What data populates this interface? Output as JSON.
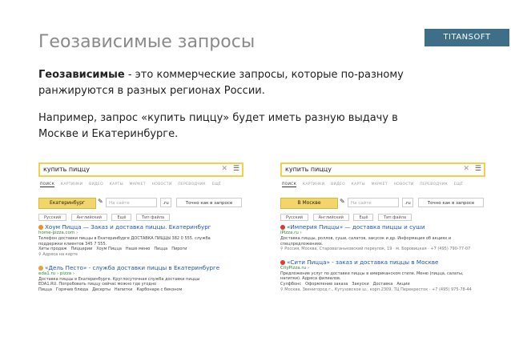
{
  "slide": {
    "title": "Геозависимые запросы",
    "logo": "TITANSOFT",
    "p1_bold": "Геозависимые",
    "p1_rest": " - это коммерческие запросы, которые по-разному ранжируются в разных регионах России.",
    "p2": "Например, запрос «купить пиццу» будет иметь разную выдачу в Москве и Екатеринбурге."
  },
  "serps": [
    {
      "query": "купить пиццу",
      "tabs": [
        "ПОИСК",
        "КАРТИНКИ",
        "ВИДЕО",
        "КАРТЫ",
        "МАРКЕТ",
        "НОВОСТИ",
        "ПЕРЕВОДЧИК",
        "ЕЩЁ"
      ],
      "region": "Екатеринбург",
      "site_placeholder": "На сайте",
      "domain": ".ru",
      "exact": "Точно как в запросе",
      "langs": [
        "Русский",
        "Английский",
        "Ещё",
        "Тип файла"
      ],
      "results": [
        {
          "title": "Хоум Пицца — Заказ и доставка пиццы. Екатеринбург",
          "url": "home-pizza.com ›",
          "snippet": [
            "Телефон доставки пиццы в Екатеринбурге ДОСТАВКА ПИЦЦЫ 382 0 555. служба",
            "поддержки клиентов 345 7 555."
          ],
          "links": [
            "Хиты продаж",
            "Пиццерии",
            "Хоум Пицца",
            "Наше меню",
            "Пицца",
            "Пироги"
          ],
          "addr": "Адреса на карте"
        },
        {
          "title": "«Дель Песто» - служба доставки пиццы в Екатеринбурге",
          "url": "eda1.ru › pizza ›",
          "snippet": [
            "Доставка пиццы в Екатеринбурге. Круглосуточная служба доставки пиццы",
            "EDA1.RU. Попробовать пиццу сейчас можно где угодно"
          ],
          "links": [
            "Пицца",
            "Горячие блюда",
            "Десерты",
            "Напитки",
            "Карбонаре с беконом"
          ],
          "addr": ""
        }
      ]
    },
    {
      "query": "купить пиццу",
      "tabs": [
        "ПОИСК",
        "КАРТИНКИ",
        "ВИДЕО",
        "КАРТЫ",
        "МАРКЕТ",
        "НОВОСТИ",
        "ПЕРЕВОДЧИК",
        "ЕЩЁ"
      ],
      "region": "В Москве",
      "site_placeholder": "На сайте",
      "domain": ".ru",
      "exact": "Точно как в запросе",
      "langs": [
        "Русский",
        "Английский",
        "Ещё",
        "Тип файла"
      ],
      "results": [
        {
          "title": "«Империя Пиццы» — доставка пиццы и суши",
          "url": "iPizza.ru ›",
          "snippet": [
            "Доставка пиццы, роллов, суши, салатов, закусок и др. Информация об акциях и",
            "спецпредложениях."
          ],
          "links": [],
          "addr": "Россия, Москва, Староваганьковский переулок, 19 · м. Боровицкая · +7 (495) 790-77-07"
        },
        {
          "title": "«Сити Пицца» - заказ и доставка пиццы в Москве",
          "url": "CityPizza.ru ›",
          "snippet": [
            "Предложение услуг по доставке пиццы в американском стиле. Меню (пицца, салаты,",
            "напитки). Адреса филиалов."
          ],
          "links": [
            "Сулфбонс",
            "Оформление заказа",
            "Закуски",
            "Доставка",
            "Акции"
          ],
          "addr": "Москва, Звенигород г., Кутузовское ш., корп.2309, ТЦ Перекресток · +7 (495) 975-78-44"
        }
      ]
    }
  ]
}
